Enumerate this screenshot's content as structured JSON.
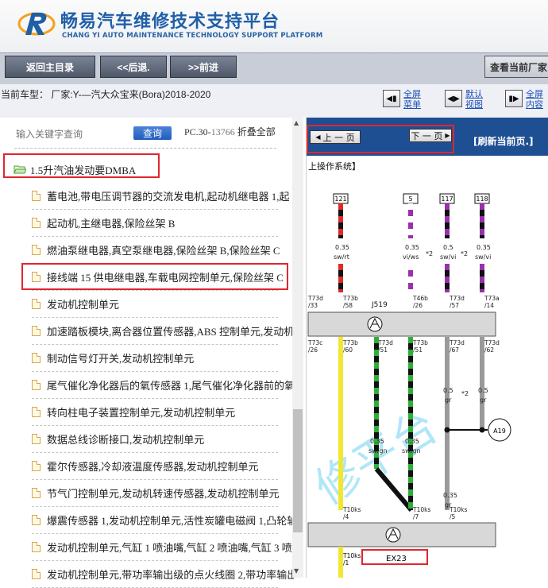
{
  "header": {
    "title_cn": "畅易汽车维修技术支持平台",
    "title_en": "CHANG YI AUTO MAINTENANCE TECHNOLOGY SUPPORT PLATFORM"
  },
  "nav": {
    "home": "返回主目录",
    "back": "<<后退.",
    "forward": ">>前进",
    "current": "查看当前厂家"
  },
  "info": {
    "car_model": "当前车型：   厂家:Y-—汽大众宝来(Bora)2018-2020",
    "btn1": "全屏菜单",
    "btn2": "默认视图",
    "btn3": "全屏内容"
  },
  "search": {
    "placeholder": "输入关键字查询",
    "button": "查询",
    "pc_prefix": "PC.30-",
    "pc_count": "13766",
    "collapse": " 折叠全部"
  },
  "tree": {
    "folder": "1.5升汽油发动要DMBA",
    "items": [
      "蓄电池,带电压调节器的交流发电机,起动机继电器 1,起",
      "起动机,主继电器,保险丝架 B",
      "燃油泵继电器,真空泵继电器,保险丝架 B,保险丝架 C",
      "接线端 15 供电继电器,车载电网控制单元,保险丝架 C",
      "发动机控制单元",
      "加速踏板模块,离合器位置传感器,ABS 控制单元,发动机",
      "制动信号灯开关,发动机控制单元",
      "尾气催化净化器后的氧传感器 1,尾气催化净化器前的氧",
      "转向柱电子装置控制单元,发动机控制单元",
      "数据总线诊断接口,发动机控制单元",
      "霍尔传感器,冷却液温度传感器,发动机控制单元",
      "节气门控制单元,发动机转速传感器,发动机控制单元",
      "爆震传感器 1,发动机控制单元,活性炭罐电磁阀 1,凸轮轴",
      "发动机控制单元,气缸 1 喷油嘴,气缸 2 喷油嘴,气缸 3 喷",
      "发动机控制单元,带功率输出级的点火线圈 2,带功率输出"
    ]
  },
  "right": {
    "prev": "上 一 页",
    "next": "下 一 页",
    "refresh": "[刷新当前页.]",
    "system_label": "上操作系统】"
  },
  "diagram": {
    "top_connectors": [
      "121",
      "5",
      "117",
      "118"
    ],
    "wire_sizes_top": [
      "0.35",
      "0.35",
      "0.5",
      "0.35"
    ],
    "wire_colors_top": [
      "sw/rt",
      "vi/ws",
      "sw/vi",
      "sw/vi"
    ],
    "mark_2": "*2",
    "pins_top": [
      "T73d\n/33",
      "T73b\n/58",
      "T46b\n/26",
      "T73d\n/57",
      "T73a\n/14"
    ],
    "j519": "J519",
    "pins_mid": [
      "T73c\n/26",
      "T73b\n/60",
      "T73d\n/51",
      "T73b\n/51",
      "T73d\n/67",
      "T73d\n/62"
    ],
    "wires_mid": [
      "0.35\nsw/gn",
      "0.35\nsw/gn",
      "0.5\ngr",
      "0.5\ngr",
      "0.35\ngr"
    ],
    "a19": "A19",
    "t10ks": [
      "T10ks\n/4",
      "T10ks\n/7",
      "T10ks\n/5"
    ],
    "t10ks_bottom": "T10ks\n/1",
    "ex": "EX23"
  },
  "colors": {
    "nav_bg": "#c9cdd8",
    "right_toolbar": "#1e4f93",
    "highlight_red": "#e0262e",
    "title_blue": "#1f5fa8"
  }
}
